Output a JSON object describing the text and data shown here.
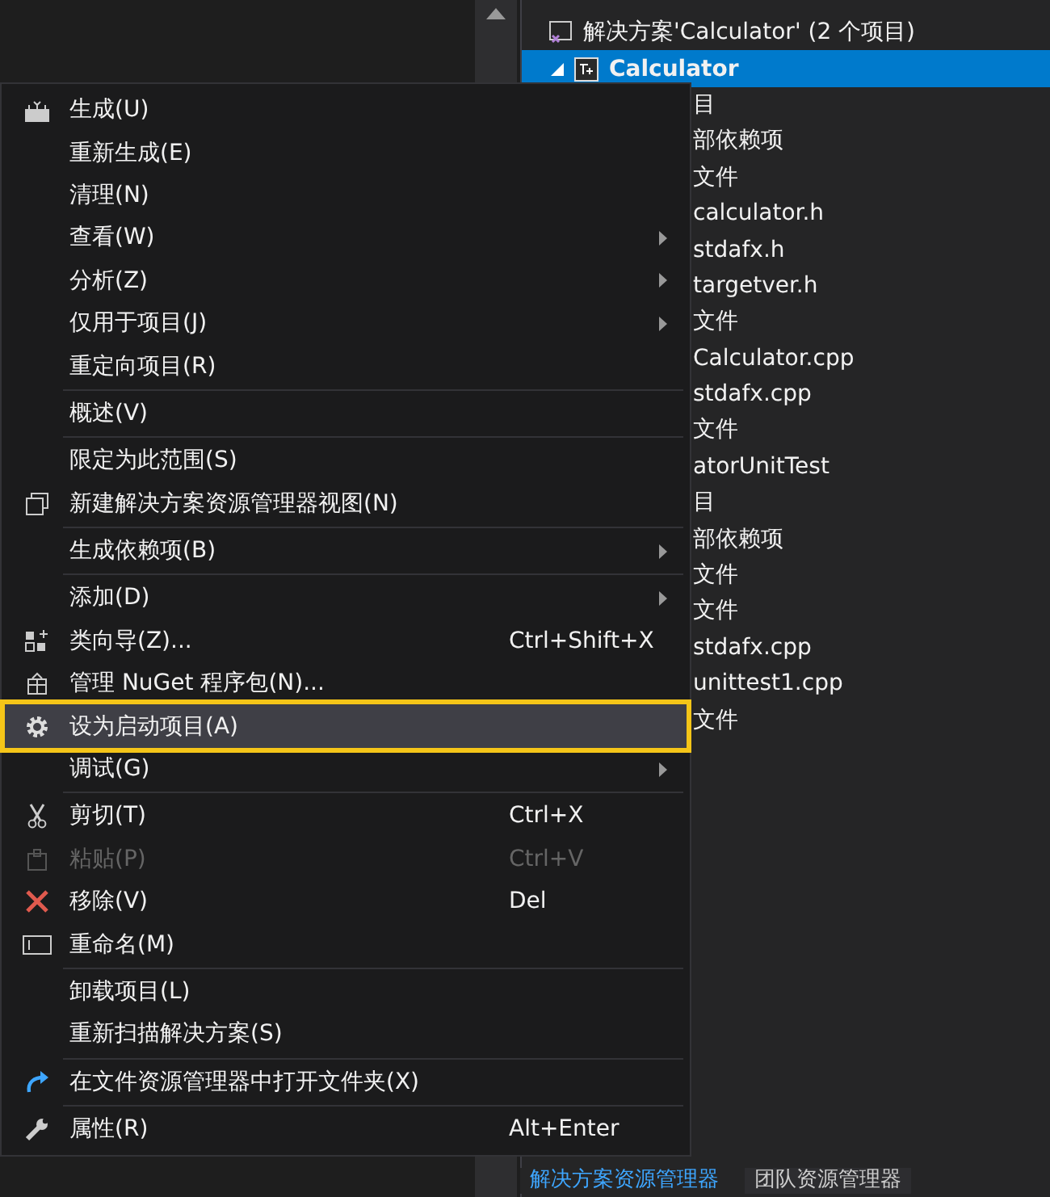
{
  "solution_explorer": {
    "solution": "解决方案'Calculator' (2 个项目)",
    "project": {
      "label": "Calculator",
      "selected": true,
      "expanded": true
    },
    "visible_items": [
      "目",
      "部依赖项",
      "文件",
      "calculator.h",
      "stdafx.h",
      "targetver.h",
      "文件",
      "Calculator.cpp",
      "stdafx.cpp",
      "文件",
      "atorUnitTest",
      "目",
      "部依赖项",
      "文件",
      "文件",
      "stdafx.cpp",
      "unittest1.cpp",
      "文件"
    ]
  },
  "bottom_tabs": [
    {
      "label": "解决方案资源管理器",
      "selected": true
    },
    {
      "label": "团队资源管理器",
      "selected": false
    }
  ],
  "context_menu": {
    "sections": [
      {
        "items": [
          {
            "label": "生成(U)",
            "submenu": false,
            "disabled": false,
            "selected": false
          },
          {
            "label": "重新生成(E)",
            "submenu": false,
            "disabled": false,
            "selected": false
          },
          {
            "label": "清理(N)",
            "submenu": false,
            "disabled": false,
            "selected": false
          },
          {
            "label": "查看(W)",
            "submenu": true,
            "disabled": false,
            "selected": false
          },
          {
            "label": "分析(Z)",
            "submenu": true,
            "disabled": false,
            "selected": false
          },
          {
            "label": "仅用于项目(J)",
            "submenu": true,
            "disabled": false,
            "selected": false
          },
          {
            "label": "重定向项目(R)",
            "submenu": false,
            "disabled": false,
            "selected": false
          }
        ]
      },
      {
        "items": [
          {
            "label": "概述(V)",
            "submenu": false,
            "disabled": false,
            "selected": false
          }
        ]
      },
      {
        "items": [
          {
            "label": "限定为此范围(S)",
            "submenu": false,
            "disabled": false,
            "selected": false
          },
          {
            "label": "新建解决方案资源管理器视图(N)",
            "submenu": false,
            "disabled": false,
            "selected": false
          }
        ]
      },
      {
        "items": [
          {
            "label": "生成依赖项(B)",
            "submenu": true,
            "disabled": false,
            "selected": false
          }
        ]
      },
      {
        "items": [
          {
            "label": "添加(D)",
            "submenu": true,
            "disabled": false,
            "selected": false
          },
          {
            "label": "类向导(Z)...",
            "shortcut": "Ctrl+Shift+X",
            "submenu": false,
            "disabled": false,
            "selected": false
          },
          {
            "label": "管理 NuGet 程序包(N)...",
            "submenu": false,
            "disabled": false,
            "selected": false
          },
          {
            "label": "设为启动项目(A)",
            "submenu": false,
            "disabled": false,
            "selected": true
          },
          {
            "label": "调试(G)",
            "submenu": true,
            "disabled": false,
            "selected": false
          }
        ]
      },
      {
        "items": [
          {
            "label": "剪切(T)",
            "shortcut": "Ctrl+X",
            "submenu": false,
            "disabled": false,
            "selected": false
          },
          {
            "label": "粘贴(P)",
            "shortcut": "Ctrl+V",
            "submenu": false,
            "disabled": true,
            "selected": false
          },
          {
            "label": "移除(V)",
            "shortcut": "Del",
            "submenu": false,
            "disabled": false,
            "selected": false
          },
          {
            "label": "重命名(M)",
            "submenu": false,
            "disabled": false,
            "selected": false
          }
        ]
      },
      {
        "items": [
          {
            "label": "卸载项目(L)",
            "submenu": false,
            "disabled": false,
            "selected": false
          },
          {
            "label": "重新扫描解决方案(S)",
            "submenu": false,
            "disabled": false,
            "selected": false
          }
        ]
      },
      {
        "items": [
          {
            "label": "在文件资源管理器中打开文件夹(X)",
            "submenu": false,
            "disabled": false,
            "selected": false
          }
        ]
      },
      {
        "items": [
          {
            "label": "属性(R)",
            "shortcut": "Alt+Enter",
            "submenu": false,
            "disabled": false,
            "selected": false
          }
        ]
      }
    ]
  }
}
